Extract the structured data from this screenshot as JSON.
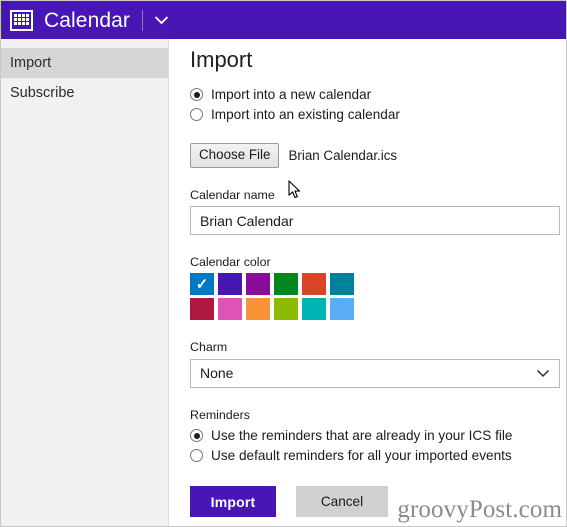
{
  "window": {
    "app_title": "Calendar",
    "app_icon": "calendar-grid-icon",
    "menu_chevron_icon": "chevron-down-icon",
    "titlebar_color": "#4716b4"
  },
  "sidebar": {
    "items": [
      {
        "label": "Import",
        "selected": true
      },
      {
        "label": "Subscribe",
        "selected": false
      }
    ]
  },
  "main": {
    "page_title": "Import",
    "import_target": {
      "options": [
        {
          "label": "Import into a new calendar",
          "selected": true
        },
        {
          "label": "Import into an existing calendar",
          "selected": false
        }
      ]
    },
    "file_picker": {
      "button_label": "Choose File",
      "file_name": "Brian Calendar.ics"
    },
    "calendar_name": {
      "label": "Calendar name",
      "value": "Brian Calendar",
      "placeholder": "Calendar name"
    },
    "calendar_color": {
      "label": "Calendar color",
      "selected_index": 0,
      "check_icon": "check-icon",
      "swatches": [
        {
          "name": "blue",
          "hex": "#0078c8"
        },
        {
          "name": "violet",
          "hex": "#4717b4"
        },
        {
          "name": "purple",
          "hex": "#8a0c9a"
        },
        {
          "name": "green",
          "hex": "#00881e"
        },
        {
          "name": "orange-red",
          "hex": "#d94526"
        },
        {
          "name": "teal",
          "hex": "#00829b"
        },
        {
          "name": "crimson",
          "hex": "#ae1841"
        },
        {
          "name": "pink",
          "hex": "#dd54b5"
        },
        {
          "name": "orange",
          "hex": "#fa9237"
        },
        {
          "name": "yellow-green",
          "hex": "#8cba00"
        },
        {
          "name": "turquoise",
          "hex": "#00b4b4"
        },
        {
          "name": "light-blue",
          "hex": "#5aaef3"
        }
      ]
    },
    "charm": {
      "label": "Charm",
      "value": "None",
      "chevron_icon": "chevron-down-icon",
      "options": [
        "None"
      ]
    },
    "reminders": {
      "label": "Reminders",
      "options": [
        {
          "label": "Use the reminders that are already in your ICS file",
          "selected": true
        },
        {
          "label": "Use default reminders for all your imported events",
          "selected": false
        }
      ]
    },
    "actions": {
      "primary_label": "Import",
      "secondary_label": "Cancel"
    }
  },
  "watermark": {
    "text": "groovyPost.com"
  }
}
